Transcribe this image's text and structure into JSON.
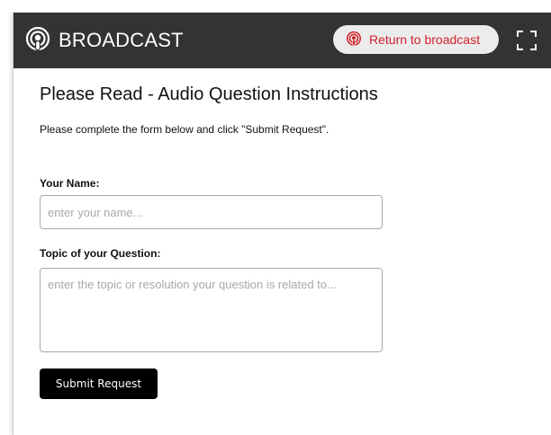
{
  "header": {
    "brand_icon": "podcast-broadcast-icon",
    "title": "BROADCAST",
    "background_color": "#333333",
    "return_button": {
      "icon": "podcast-broadcast-icon",
      "label": "Return to broadcast",
      "text_color": "#d4202a",
      "background_color": "#ececec"
    },
    "fullscreen_icon": "fullscreen-icon"
  },
  "main": {
    "title": "Please Read - Audio Question Instructions",
    "instructions": "Please complete the form below and click \"Submit Request\".",
    "form": {
      "name_label": "Your Name:",
      "name_value": "",
      "name_placeholder": "enter your name...",
      "topic_label": "Topic of your Question:",
      "topic_value": "",
      "topic_placeholder": "enter the topic or resolution your question is related to...",
      "submit_label": "Submit Request"
    }
  }
}
